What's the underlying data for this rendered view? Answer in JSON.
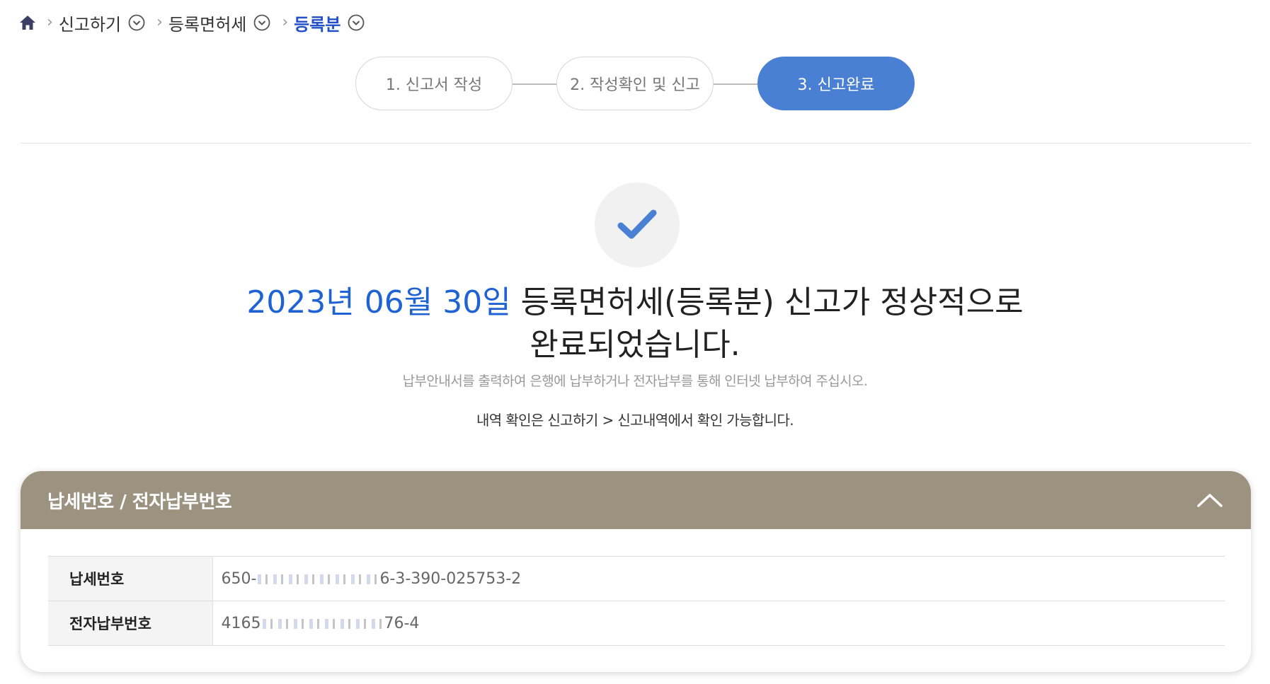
{
  "breadcrumb": {
    "items": [
      {
        "label": "신고하기"
      },
      {
        "label": "등록면허세"
      },
      {
        "label": "등록분"
      }
    ]
  },
  "steps": [
    {
      "label": "1. 신고서 작성",
      "active": false
    },
    {
      "label": "2. 작성확인 및 신고",
      "active": false
    },
    {
      "label": "3. 신고완료",
      "active": true
    }
  ],
  "result": {
    "date_text": "2023년 06월 30일",
    "message_line1": " 등록면허세(등록분) 신고가 정상적으로",
    "message_line2": "완료되었습니다.",
    "guide": "납부안내서를 출력하여 은행에 납부하거나 전자납부를 통해 인터넷 납부하여 주십시오.",
    "history_note": "내역 확인은 신고하기 > 신고내역에서 확인 가능합니다."
  },
  "panel": {
    "title": "납세번호 / 전자납부번호",
    "rows": [
      {
        "label": "납세번호",
        "value_start": "650-",
        "value_end": "6-3-390-025753-2"
      },
      {
        "label": "전자납부번호",
        "value_start": "4165",
        "value_end": "76-4"
      }
    ]
  },
  "colors": {
    "accent": "#4a80d4",
    "date_blue": "#1e62d4",
    "panel_header": "#9b9280"
  },
  "icons": {
    "home": "home-icon",
    "separator": "chevron-right-icon",
    "dropdown": "chevron-down-circle-icon",
    "check": "check-icon",
    "collapse": "chevron-up-icon"
  }
}
